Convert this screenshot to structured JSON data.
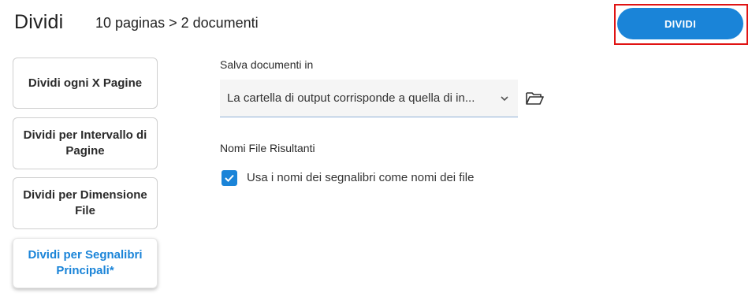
{
  "header": {
    "title": "Dividi",
    "summary": "10 paginas > 2 documenti",
    "primary_button_label": "DIVIDI",
    "highlight_color": "#e01313",
    "accent_color": "#1a84d8"
  },
  "modes": [
    {
      "label": "Dividi ogni X Pagine",
      "active": false
    },
    {
      "label": "Dividi per Intervallo di Pagine",
      "active": false
    },
    {
      "label": "Dividi per Dimensione File",
      "active": false
    },
    {
      "label": "Dividi per Segnalibri Principali*",
      "active": true
    }
  ],
  "output": {
    "label": "Salva documenti in",
    "selected_value": "La cartella di output corrisponde a quella di in...",
    "browse_icon": "folder-open-icon",
    "dropdown_icon": "chevron-down-icon"
  },
  "filenames": {
    "label": "Nomi File Risultanti",
    "use_bookmark_names_label": "Usa i nomi dei segnalibri come nomi dei file",
    "use_bookmark_names_checked": true,
    "check_icon": "check-icon"
  }
}
